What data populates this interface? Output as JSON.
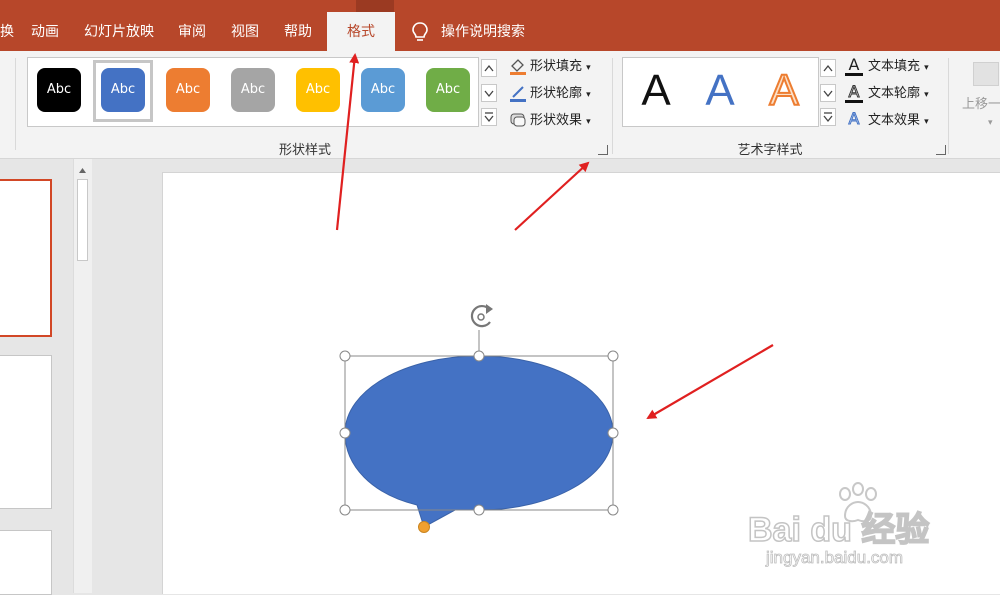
{
  "tabs": {
    "partial_left": "换",
    "animations": "动画",
    "slideshow": "幻灯片放映",
    "review": "审阅",
    "view": "视图",
    "help": "帮助",
    "format": "格式",
    "tell_me": "操作说明搜索"
  },
  "shape_styles": {
    "label": "形状样式",
    "swatches": [
      {
        "text": "Abc",
        "color": "#000000",
        "selected": false
      },
      {
        "text": "Abc",
        "color": "#4472c4",
        "selected": true
      },
      {
        "text": "Abc",
        "color": "#ed7d31",
        "selected": false
      },
      {
        "text": "Abc",
        "color": "#a5a5a5",
        "selected": false
      },
      {
        "text": "Abc",
        "color": "#ffc000",
        "selected": false
      },
      {
        "text": "Abc",
        "color": "#5b9bd5",
        "selected": false
      },
      {
        "text": "Abc",
        "color": "#70ad47",
        "selected": false
      }
    ],
    "fill": "形状填充",
    "outline": "形状轮廓",
    "effects": "形状效果"
  },
  "wordart_styles": {
    "label": "艺术字样式",
    "samples": [
      "A",
      "A",
      "A"
    ],
    "text_fill": "文本填充",
    "text_outline": "文本轮廓",
    "text_effects": "文本效果"
  },
  "arrange": {
    "bring_forward": "上移一"
  },
  "colors": {
    "accent": "#b7472a",
    "shape_fill": "#4472c4",
    "annotation_arrow": "#e02020",
    "adjust_handle": "#f0a030"
  },
  "watermark": {
    "brand": "Bai du 经验",
    "url": "jingyan.baidu.com"
  }
}
